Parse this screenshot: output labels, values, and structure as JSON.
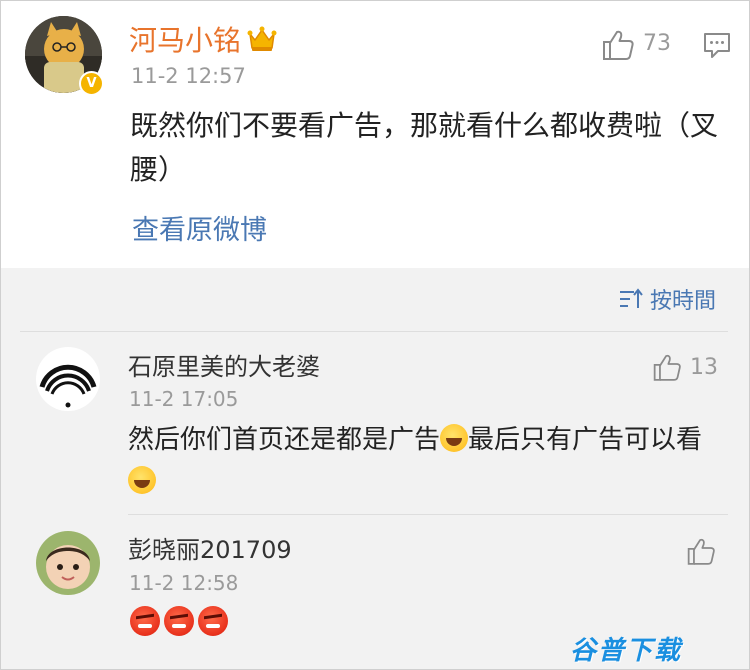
{
  "post": {
    "author": "河马小铭",
    "verified_badge": "V",
    "time": "11-2 12:57",
    "like_count": "73",
    "body": "既然你们不要看广告，那就看什么都收费啦（叉腰）",
    "view_original": "查看原微博"
  },
  "sort": {
    "label": "按時間"
  },
  "replies": [
    {
      "author": "石原里美的大老婆",
      "time": "11-2 17:05",
      "like_count": "13",
      "text_part1": "然后你们首页还是都是广告",
      "text_part2": "最后只有广告可以看"
    },
    {
      "author": "彭晓丽201709",
      "time": "11-2 12:58",
      "like_count": "",
      "emoji_count": 3
    }
  ],
  "watermark": "谷普下载",
  "colors": {
    "author_name": "#e8742c",
    "link": "#4a78b3",
    "muted": "#9a9a9a",
    "card_bg": "#ffffff",
    "list_bg": "#f2f2f2"
  }
}
